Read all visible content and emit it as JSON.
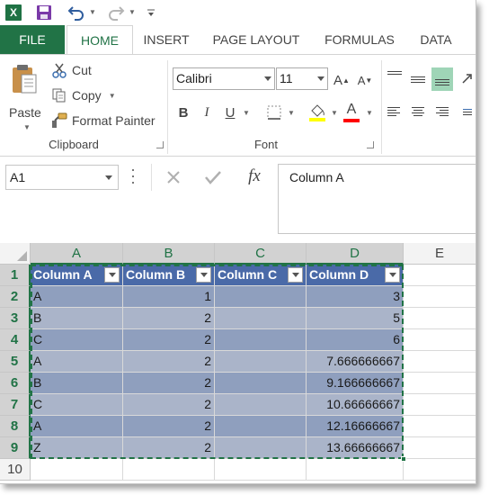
{
  "qat": {
    "app_icon": "excel-logo-icon",
    "app_letter": "X",
    "save": "save-icon",
    "undo": "undo-icon",
    "redo": "redo-icon"
  },
  "tabs": [
    {
      "label": "FILE"
    },
    {
      "label": "HOME"
    },
    {
      "label": "INSERT"
    },
    {
      "label": "PAGE LAYOUT"
    },
    {
      "label": "FORMULAS"
    },
    {
      "label": "DATA"
    }
  ],
  "clipboard": {
    "paste_label": "Paste",
    "cut_label": "Cut",
    "copy_label": "Copy",
    "format_painter_label": "Format Painter",
    "group_label": "Clipboard"
  },
  "font": {
    "name": "Calibri",
    "size": "11",
    "bold": "B",
    "italic": "I",
    "underline": "U",
    "grow": "A",
    "shrink": "A",
    "color_letter": "A",
    "group_label": "Font"
  },
  "formula_bar": {
    "name_box": "A1",
    "fx": "fx",
    "content": "Column A"
  },
  "grid": {
    "columns": [
      "A",
      "B",
      "C",
      "D",
      "E"
    ],
    "rows": [
      "1",
      "2",
      "3",
      "4",
      "5",
      "6",
      "7",
      "8",
      "9",
      "10"
    ],
    "headers": [
      "Column A",
      "Column B",
      "Column C",
      "Column D"
    ],
    "data": [
      [
        "A",
        "1",
        "",
        "3"
      ],
      [
        "B",
        "2",
        "",
        "5"
      ],
      [
        "C",
        "2",
        "",
        "6"
      ],
      [
        "A",
        "2",
        "",
        "7.666666667"
      ],
      [
        "B",
        "2",
        "",
        "9.166666667"
      ],
      [
        "C",
        "2",
        "",
        "10.66666667"
      ],
      [
        "A",
        "2",
        "",
        "12.16666667"
      ],
      [
        "Z",
        "2",
        "",
        "13.66666667"
      ]
    ]
  },
  "colors": {
    "excel_green": "#217346",
    "table_header": "#4a6aa8",
    "band_dark": "#8f9fbe",
    "band_light": "#aab4c9",
    "highlight_yellow": "#ffff00",
    "font_red": "#ff0000"
  }
}
